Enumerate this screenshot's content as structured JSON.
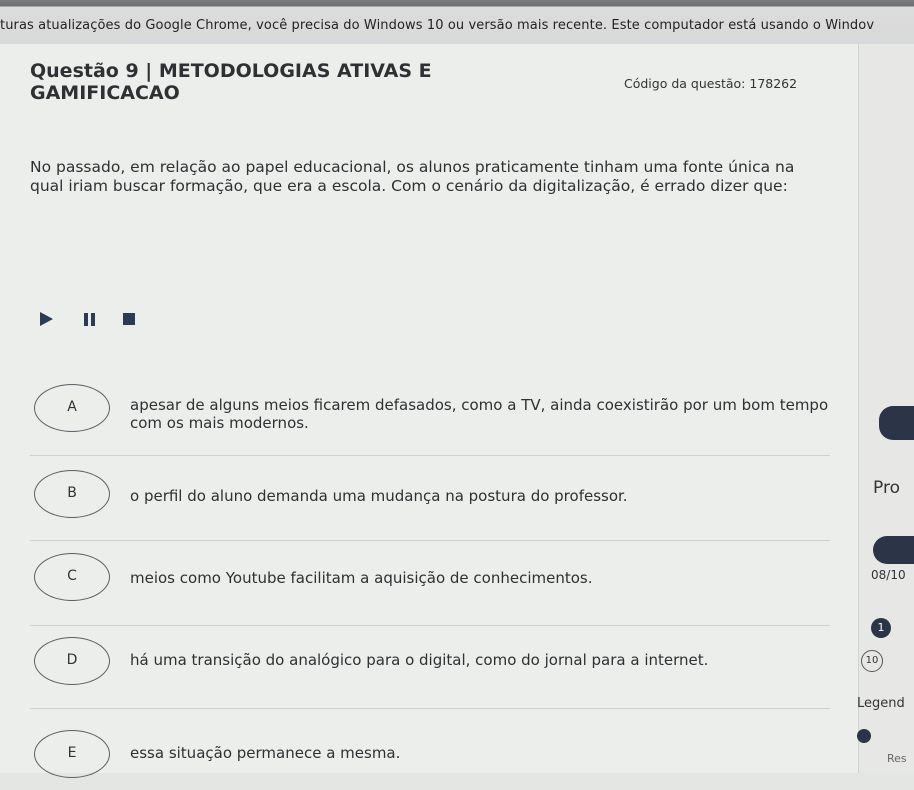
{
  "browser": {
    "banner_text": "turas atualizações do Google Chrome, você precisa do Windows 10 ou versão mais recente. Este computador está usando o Windov"
  },
  "question": {
    "title": "Questão 9 | METODOLOGIAS ATIVAS E GAMIFICACAO",
    "code": "Código da questão: 178262",
    "text": "No passado, em relação ao papel educacional, os alunos praticamente tinham uma fonte única na qual iriam buscar formação, que era a escola. Com o cenário da digitalização, é errado dizer que:"
  },
  "player": {
    "play_icon": "play-icon",
    "pause_icon": "pause-icon",
    "stop_icon": "stop-icon"
  },
  "options": [
    {
      "letter": "A",
      "text": "apesar de alguns meios ficarem defasados, como a TV, ainda coexistirão por um bom tempo com os mais modernos."
    },
    {
      "letter": "B",
      "text": "o perfil do aluno demanda uma mudança na postura do professor."
    },
    {
      "letter": "C",
      "text": "meios como Youtube facilitam a aquisição de conhecimentos."
    },
    {
      "letter": "D",
      "text": "há uma transição do analógico para o digital, como do jornal para a internet."
    },
    {
      "letter": "E",
      "text": "essa situação permanece a mesma."
    }
  ],
  "sidebar": {
    "label_pro": "Pro",
    "progress": "08/10",
    "badge_1": "1",
    "badge_10": "10",
    "legend": "Legend",
    "legend_item": "Res"
  },
  "colors": {
    "accent": "#2c3447",
    "background": "#eceeeb"
  }
}
